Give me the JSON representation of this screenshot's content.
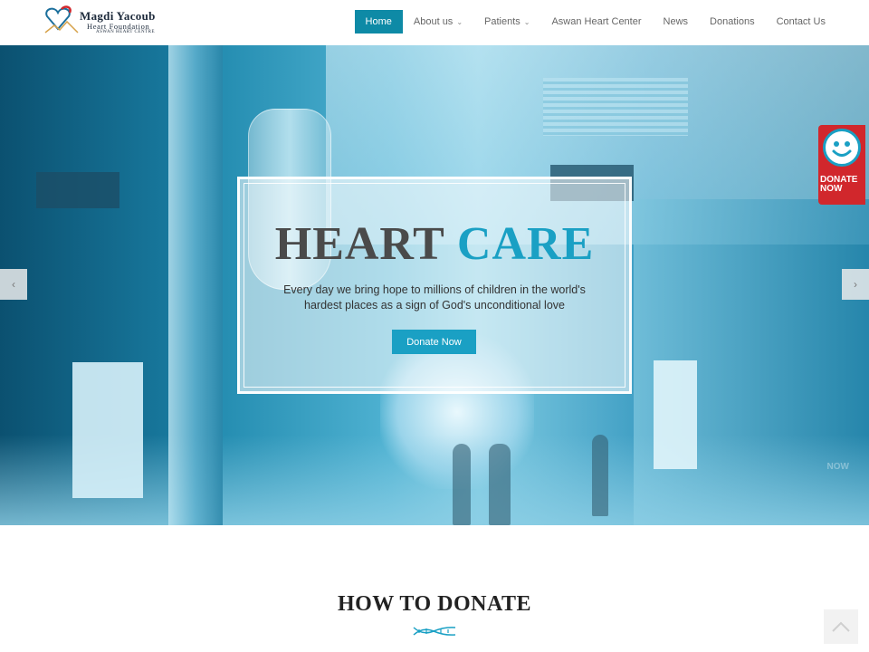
{
  "brand": {
    "name_line1": "Magdi Yacoub",
    "name_line2": "Heart Foundation",
    "name_line3": "ASWAN HEART CENTRE"
  },
  "nav": {
    "items": [
      {
        "label": "Home",
        "active": true,
        "dropdown": false
      },
      {
        "label": "About us",
        "active": false,
        "dropdown": true
      },
      {
        "label": "Patients",
        "active": false,
        "dropdown": true
      },
      {
        "label": "Aswan Heart Center",
        "active": false,
        "dropdown": false
      },
      {
        "label": "News",
        "active": false,
        "dropdown": false
      },
      {
        "label": "Donations",
        "active": false,
        "dropdown": false
      },
      {
        "label": "Contact Us",
        "active": false,
        "dropdown": false
      }
    ]
  },
  "hero": {
    "title_part1": "HEART",
    "title_part2": "CARE",
    "text": "Every day we bring hope to millions of children in the world's hardest places as a sign of God's unconditional love",
    "button_label": "Donate Now"
  },
  "slider": {
    "prev_icon": "chevron-left-icon",
    "next_icon": "chevron-right-icon"
  },
  "donate_badge": {
    "line1": "DONATE",
    "line2": "NOW"
  },
  "ghost_text": "NOW",
  "section": {
    "title": "HOW TO DONATE"
  },
  "colors": {
    "accent": "#1aa0c4",
    "nav_active": "#0e8aa6",
    "badge_red": "#d1272c"
  }
}
